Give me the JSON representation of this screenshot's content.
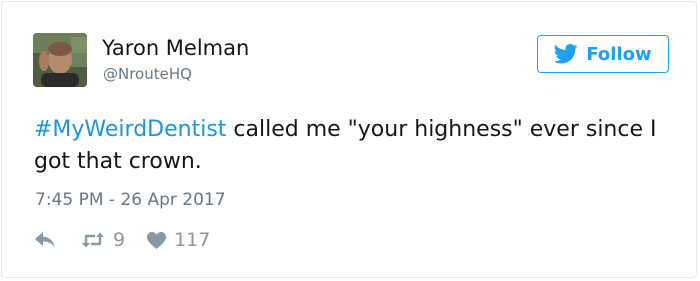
{
  "tweet": {
    "author_name": "Yaron Melman",
    "author_handle": "@NrouteHQ",
    "follow_label": "Follow",
    "hashtag": "#MyWeirdDentist",
    "text_rest": " called me \"your highness\" ever since I got that crown.",
    "timestamp": "7:45 PM - 26 Apr 2017",
    "retweet_count": "9",
    "like_count": "117"
  },
  "colors": {
    "accent": "#1da1f2",
    "hashtag": "#1b95e0",
    "muted": "#657786",
    "action": "#8899a6",
    "border": "#e1e8ed"
  },
  "icons": {
    "follow": "twitter-bird-icon",
    "reply": "reply-arrow-icon",
    "retweet": "retweet-icon",
    "like": "heart-icon"
  }
}
